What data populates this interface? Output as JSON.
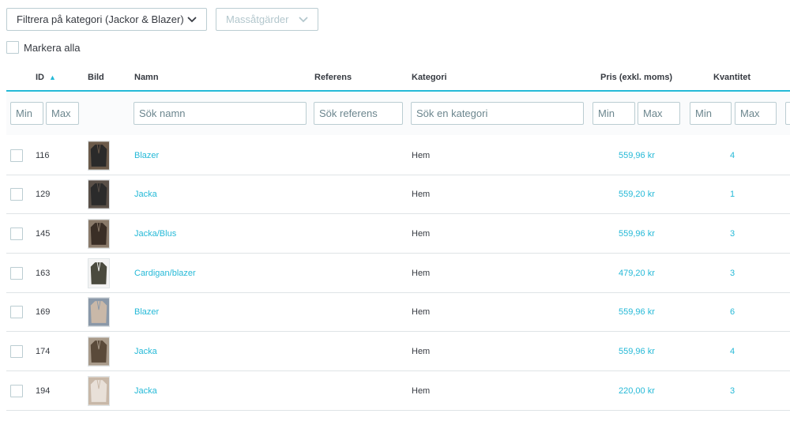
{
  "toolbar": {
    "category_filter_label": "Filtrera på kategori (Jackor & Blazer)",
    "bulk_actions_label": "Massåtgärder",
    "select_all_label": "Markera alla"
  },
  "columns": {
    "id": "ID",
    "image": "Bild",
    "name": "Namn",
    "reference": "Referens",
    "category": "Kategori",
    "price": "Pris (exkl. moms)",
    "quantity": "Kvantitet"
  },
  "filters": {
    "id_min": "Min",
    "id_max": "Max",
    "name": "Sök namn",
    "reference": "Sök referens",
    "category": "Sök en kategori",
    "price_min": "Min",
    "price_max": "Max",
    "qty_min": "Min",
    "qty_max": "Max"
  },
  "colors": {
    "accent": "#25b9d7",
    "border": "#bbcdd2"
  },
  "rows": [
    {
      "id": "116",
      "name": "Blazer",
      "reference": "",
      "category": "Hem",
      "price": "559,96 kr",
      "quantity": "4",
      "thumb_colors": [
        "#2a2a2a",
        "#6b5a4a"
      ]
    },
    {
      "id": "129",
      "name": "Jacka",
      "reference": "",
      "category": "Hem",
      "price": "559,20 kr",
      "quantity": "1",
      "thumb_colors": [
        "#2b2b2b",
        "#5a5048"
      ]
    },
    {
      "id": "145",
      "name": "Jacka/Blus",
      "reference": "",
      "category": "Hem",
      "price": "559,96 kr",
      "quantity": "3",
      "thumb_colors": [
        "#3a2e26",
        "#8a7a6a"
      ]
    },
    {
      "id": "163",
      "name": "Cardigan/blazer",
      "reference": "",
      "category": "Hem",
      "price": "479,20 kr",
      "quantity": "3",
      "thumb_colors": [
        "#4a4a3e",
        "#f2f2f2"
      ]
    },
    {
      "id": "169",
      "name": "Blazer",
      "reference": "",
      "category": "Hem",
      "price": "559,96 kr",
      "quantity": "6",
      "thumb_colors": [
        "#c9b8a8",
        "#8a98a8"
      ]
    },
    {
      "id": "174",
      "name": "Jacka",
      "reference": "",
      "category": "Hem",
      "price": "559,96 kr",
      "quantity": "4",
      "thumb_colors": [
        "#5a4a3a",
        "#a89a8a"
      ]
    },
    {
      "id": "194",
      "name": "Jacka",
      "reference": "",
      "category": "Hem",
      "price": "220,00 kr",
      "quantity": "3",
      "thumb_colors": [
        "#e8e0d8",
        "#c8b8a8"
      ]
    }
  ]
}
